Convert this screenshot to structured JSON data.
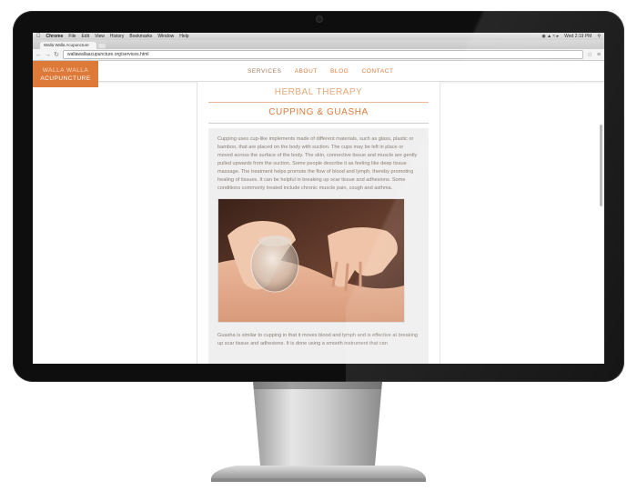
{
  "menubar": {
    "items": [
      "Chrome",
      "File",
      "Edit",
      "View",
      "History",
      "Bookmarks",
      "Window",
      "Help"
    ],
    "clock": "Wed 2:19 PM"
  },
  "browser": {
    "tab_title": "Walla Walla Acupuncture",
    "url": "wallawallaacupuncture.org/services.html"
  },
  "site": {
    "logo_line1": "WALLA WALLA",
    "logo_line2": "ACUPUNCTURE",
    "nav": [
      "SERVICES",
      "ABOUT",
      "BLOG",
      "CONTACT"
    ],
    "accent_color": "#dd7a39"
  },
  "page": {
    "herbal_heading": "HERBAL THERAPY",
    "cupping_heading": "CUPPING & GUASHA",
    "cupping_text": "Cupping uses cup-like implements made of different materials, such as glass, plastic or bamboo, that are placed on the body with suction. The cups may be left in place or moved across the surface of the body. The skin, connective tissue and muscle are gently pulled upwards from the suction. Some people describe it as feeling like deep tissue massage. The treatment helps promote the flow of blood and lymph, thereby promoting healing of tissues. It can be helpful in breaking up scar tissue and adhesions. Some conditions commonly treated include chronic muscle pain, cough and asthma.",
    "guasha_text": "Guasha is similar to cupping in that it moves blood and lymph and is effective at breaking up scar tissue and adhesions. It is done using a smooth instrument that can"
  }
}
